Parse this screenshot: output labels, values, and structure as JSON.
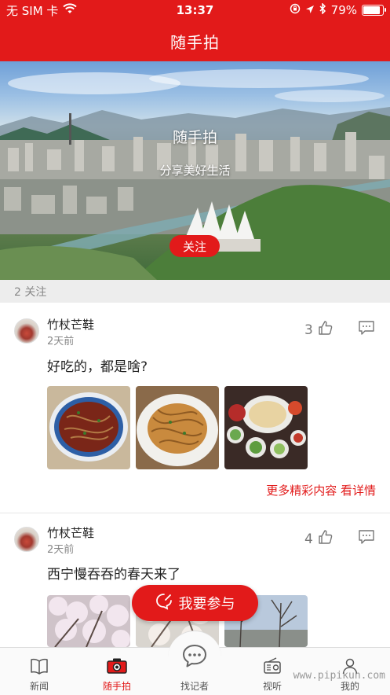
{
  "status_bar": {
    "carrier": "无 SIM 卡",
    "time": "13:37",
    "battery_percent": "79%",
    "battery_level": 0.79
  },
  "nav": {
    "title": "随手拍"
  },
  "banner": {
    "title": "随手拍",
    "subtitle": "分享美好生活",
    "follow_label": "关注"
  },
  "follow_count": "2 关注",
  "posts": [
    {
      "user": "竹杖芒鞋",
      "time": "2天前",
      "likes": "3",
      "text": "好吃的，都是啥?",
      "more_label": "更多精彩内容 看详情"
    },
    {
      "user": "竹杖芒鞋",
      "time": "2天前",
      "likes": "4",
      "text": "西宁慢吞吞的春天来了"
    }
  ],
  "join_button": {
    "label": "我要参与"
  },
  "tabs": [
    {
      "label": "新闻",
      "icon": "book-icon"
    },
    {
      "label": "随手拍",
      "icon": "camera-icon",
      "active": true
    },
    {
      "label": "找记者",
      "icon": "chat-bubble-icon"
    },
    {
      "label": "视听",
      "icon": "radio-icon"
    },
    {
      "label": "我的",
      "icon": "person-icon"
    }
  ],
  "watermark": "www.pipikun.com",
  "colors": {
    "accent": "#e21a1a"
  }
}
